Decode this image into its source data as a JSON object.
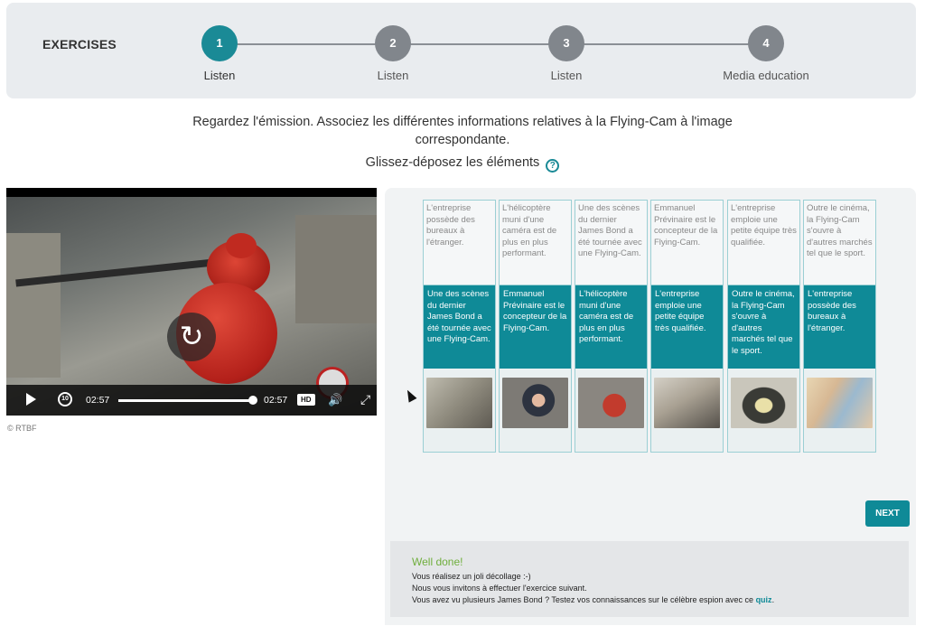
{
  "stepper": {
    "title": "EXERCISES",
    "steps": [
      {
        "number": "1",
        "label": "Listen",
        "active": true
      },
      {
        "number": "2",
        "label": "Listen",
        "active": false
      },
      {
        "number": "3",
        "label": "Listen",
        "active": false
      },
      {
        "number": "4",
        "label": "Media education",
        "active": false
      }
    ]
  },
  "instructions": {
    "main": "Regardez l'émission. Associez les différentes informations relatives à la Flying-Cam à l'image correspondante.",
    "drag_hint": "Glissez-déposez les éléments"
  },
  "video": {
    "current_time": "02:57",
    "duration": "02:57",
    "quality": "HD",
    "replay_seconds": "10",
    "progress": 1.0,
    "credit": "© RTBF"
  },
  "columns": [
    {
      "target": "L'entreprise possède des bureaux à l'étranger.",
      "card": "Une des scènes du dernier James Bond a été tournée avec une Flying-Cam."
    },
    {
      "target": "L'hélicoptère muni d'une caméra est de plus en plus performant.",
      "card": "Emmanuel Prévinaire est le concepteur de la Flying-Cam."
    },
    {
      "target": "Une des scènes du dernier James Bond a été tournée avec une Flying-Cam.",
      "card": "L'hélicoptère muni d'une caméra est de plus en plus performant."
    },
    {
      "target": "Emmanuel Prévinaire est le concepteur de la Flying-Cam.",
      "card": "L'entreprise emploie une petite équipe très qualifiée."
    },
    {
      "target": "L'entreprise emploie une petite équipe très qualifiée.",
      "card": "Outre le cinéma, la Flying-Cam s'ouvre à d'autres marchés tel que le sport."
    },
    {
      "target": "Outre le cinéma, la Flying-Cam s'ouvre à d'autres marchés tel que le sport.",
      "card": "L'entreprise possède des bureaux à l'étranger."
    }
  ],
  "next_label": "NEXT",
  "feedback": {
    "title": "Well done!",
    "line1": "Vous réalisez un joli décollage :-)",
    "line2": "Nous vous invitons à effectuer l'exercice suivant.",
    "line3": "Vous avez vu plusieurs James Bond ? Testez vos connaissances sur le célèbre espion avec ce",
    "link": "quiz",
    "end": "."
  },
  "colors": {
    "accent": "#0f8a97",
    "success": "#6fae3c",
    "step_inactive": "#81868c"
  }
}
